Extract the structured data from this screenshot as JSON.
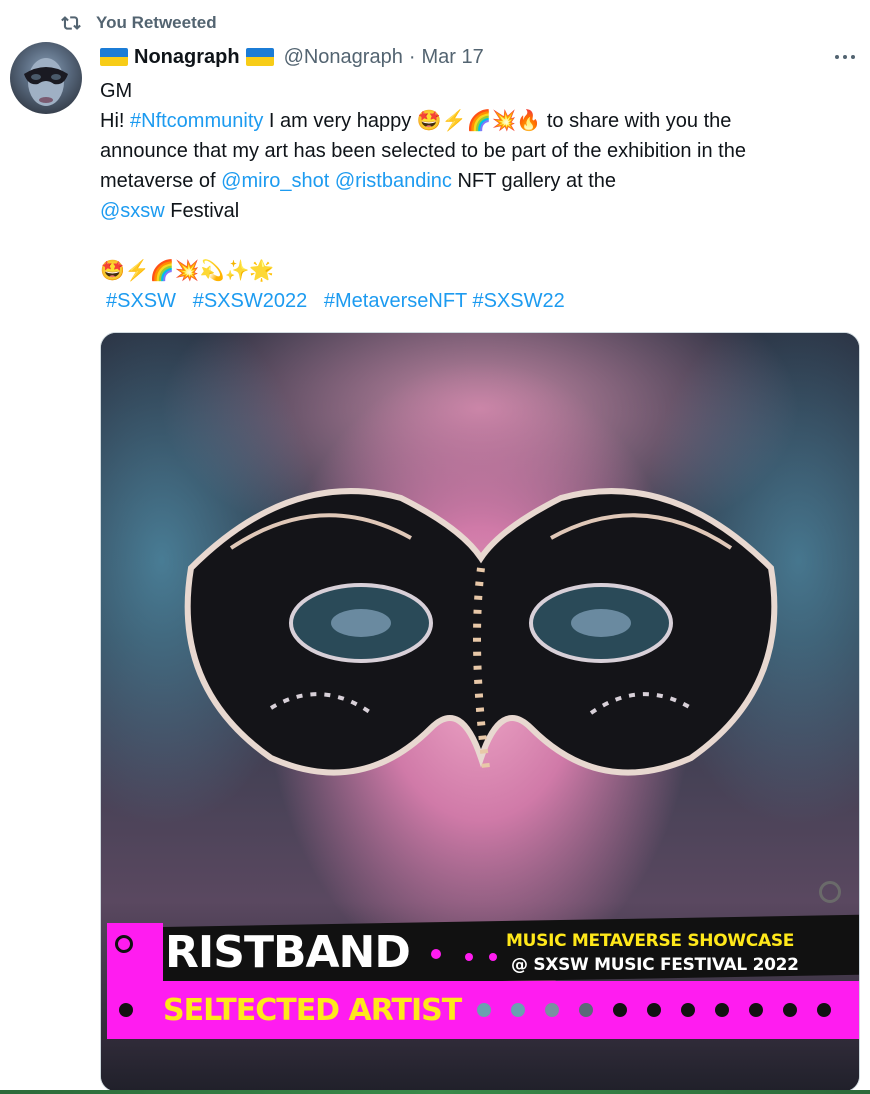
{
  "retweet": {
    "label": "You Retweeted"
  },
  "tweet": {
    "name": "Nonagraph",
    "handle": "@Nonagraph",
    "separator": "·",
    "date": "Mar 17",
    "lines": {
      "l1": "GM",
      "l2_prefix": "Hi! ",
      "l2_tag": "#Nftcommunity",
      "l2_mid": " I am very happy ",
      "l2_emoji": "🤩⚡🌈💥🔥",
      "l2_suffix": " to share with you the",
      "l3": "announce that my art has been selected to be part of the exhibition in the",
      "l4_prefix": "metaverse of  ",
      "l4_m1": "@miro_shot",
      "l4_m2": "@ristbandinc",
      "l4_suffix": "  NFT gallery at the",
      "l5_mention": "@sxsw",
      "l5_suffix": " Festival",
      "l6_emoji": "🤩⚡🌈💥💫✨🌟",
      "l7_tags": [
        "#SXSW",
        "#SXSW2022",
        "#MetaverseNFT",
        "#SXSW22"
      ]
    }
  },
  "media": {
    "brand": "RISTBAND",
    "showcase_line1": "MUSIC METAVERSE SHOWCASE",
    "showcase_line2": "@ SXSW MUSIC FESTIVAL 2022",
    "selected": "SELTECTED ARTIST"
  },
  "colors": {
    "link": "#1d9bf0",
    "muted": "#536471",
    "pink": "#ff1cf0",
    "yellow": "#ffe81a"
  }
}
